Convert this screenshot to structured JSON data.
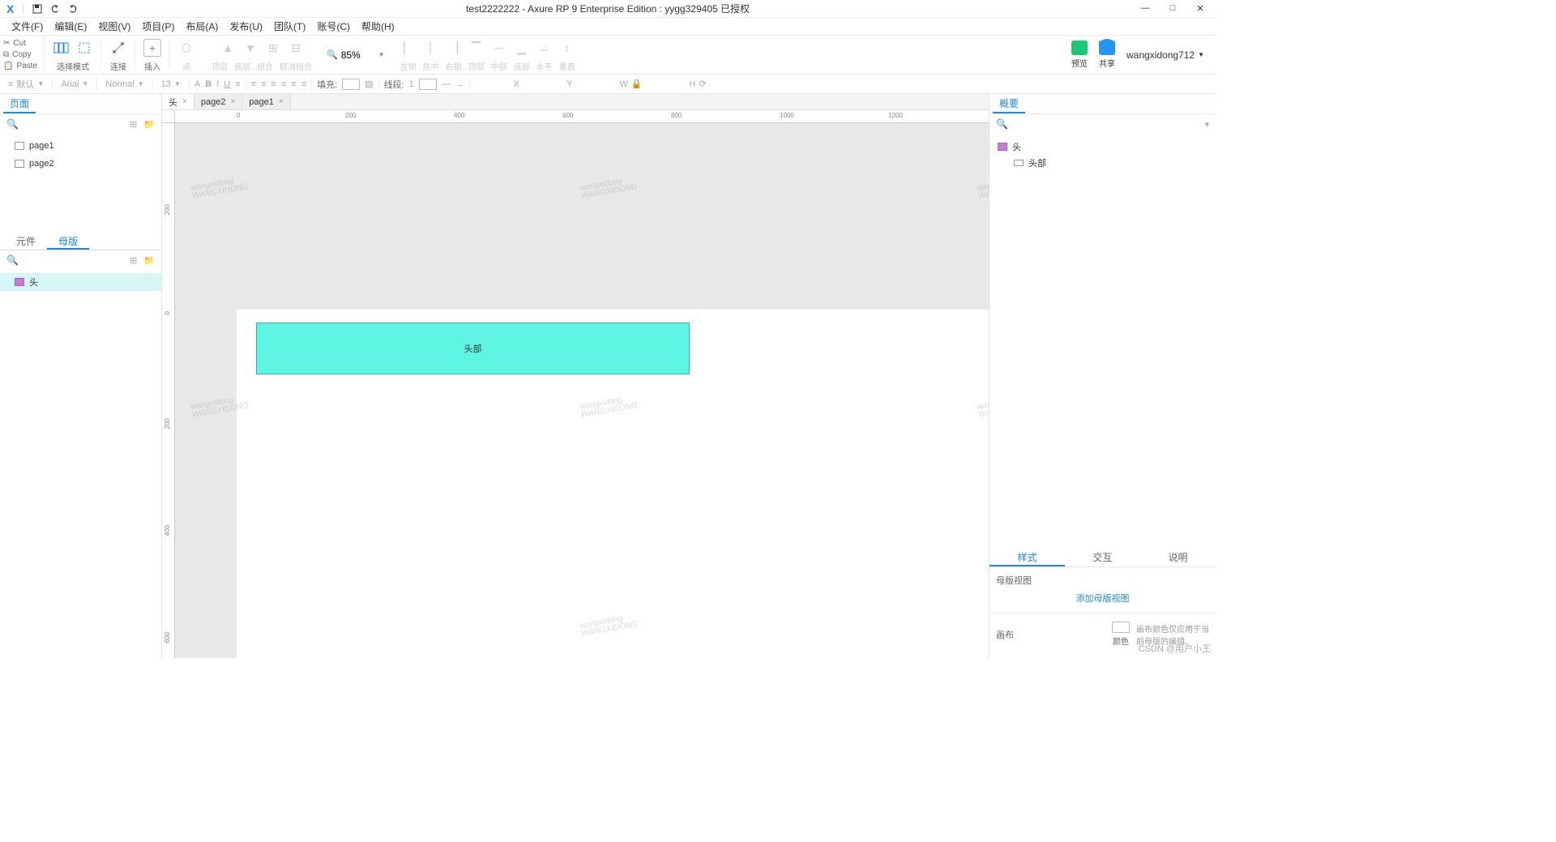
{
  "title": "test2222222 - Axure RP 9 Enterprise Edition : yygg329405 已授权",
  "menus": {
    "file": "文件(F)",
    "edit": "编辑(E)",
    "view": "视图(V)",
    "project": "项目(P)",
    "layout": "布局(A)",
    "publish": "发布(U)",
    "team": "团队(T)",
    "account": "账号(C)",
    "help": "帮助(H)"
  },
  "clip": {
    "cut": "Cut",
    "copy": "Copy",
    "paste": "Paste"
  },
  "toolbar": {
    "select_mode": "选择模式",
    "connect": "连接",
    "insert": "插入",
    "point": "点",
    "top_layer": "顶层",
    "bottom_layer": "底层",
    "group": "组合",
    "ungroup": "取消组合",
    "zoom": "85%",
    "align_left": "左侧",
    "align_center": "居中",
    "align_right": "右侧",
    "align_top": "顶部",
    "align_middle": "中部",
    "align_bottom": "底部",
    "dist_h": "水平",
    "dist_v": "垂直",
    "preview": "预览",
    "share": "共享"
  },
  "formatbar": {
    "style": "默认",
    "font": "Arial",
    "weight": "Normal",
    "size": "13",
    "fill_label": "填充:",
    "line_label": "线段:",
    "line_w": "1",
    "x": "X",
    "y": "Y",
    "w": "W",
    "h": "H"
  },
  "left": {
    "pages_title": "页面",
    "page1": "page1",
    "page2": "page2",
    "widgets_title": "元件",
    "masters_title": "母版",
    "master_head": "头"
  },
  "canvas": {
    "tab_head": "头",
    "tab_page2": "page2",
    "tab_page1": "page1",
    "shape_text": "头部",
    "rulers_h": [
      "0",
      "200",
      "400",
      "600",
      "800",
      "1000",
      "1200"
    ],
    "rulers_v": [
      "200",
      "0",
      "200",
      "400",
      "600"
    ],
    "watermark1": "wangxidong",
    "watermark2": "WANGXIDONG"
  },
  "right": {
    "outline_title": "概要",
    "outline_head": "头",
    "outline_child": "头部",
    "tab_style": "样式",
    "tab_interact": "交互",
    "tab_notes": "说明",
    "master_view": "母版视图",
    "add_master_view": "添加母版视图",
    "canvas_label": "画布",
    "color_label": "颜色",
    "canvas_note": "画布颜色仅应用于当前母版的编辑。"
  },
  "user": "wangxidong712",
  "footer": "CSDN @用户小王"
}
